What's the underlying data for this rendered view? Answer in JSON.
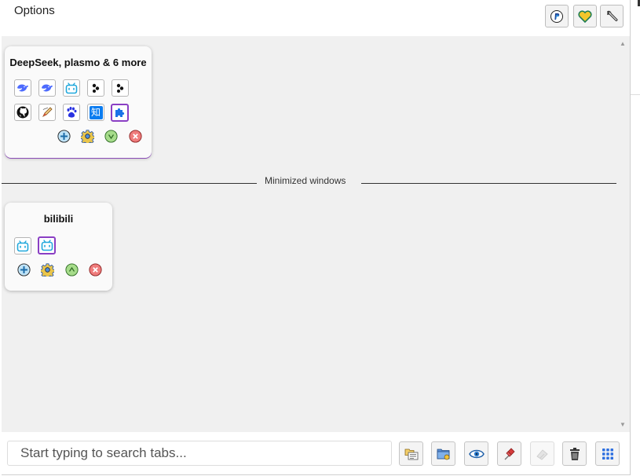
{
  "header": {
    "title": "Options"
  },
  "header_buttons": [
    {
      "name": "paypal-button",
      "icon": "paypal-icon"
    },
    {
      "name": "favorite-button",
      "icon": "heart-icon"
    },
    {
      "name": "settings-button",
      "icon": "wrench-icon"
    }
  ],
  "windows": [
    {
      "title": "DeepSeek, plasmo & 6 more",
      "tabs": [
        {
          "icon": "deepseek-icon"
        },
        {
          "icon": "deepseek-icon"
        },
        {
          "icon": "bilibili-icon"
        },
        {
          "icon": "plasmo-icon"
        },
        {
          "icon": "plasmo-icon"
        },
        {
          "icon": "github-icon"
        },
        {
          "icon": "extension-pencil-icon"
        },
        {
          "icon": "baidu-icon"
        },
        {
          "icon": "zhihu-icon",
          "text": "知"
        },
        {
          "icon": "puzzle-icon",
          "active": true
        }
      ],
      "actions": [
        "new-tab-icon",
        "settings-gear-icon",
        "minimize-icon",
        "close-window-icon"
      ]
    },
    {
      "title": "bilibili",
      "tabs": [
        {
          "icon": "bilibili-icon"
        },
        {
          "icon": "bilibili-icon",
          "active": true
        }
      ],
      "actions": [
        "new-tab-icon",
        "settings-gear-icon",
        "restore-icon",
        "close-window-icon"
      ]
    }
  ],
  "separator": {
    "label": "Minimized windows"
  },
  "search": {
    "placeholder": "Start typing to search tabs..."
  },
  "footer_buttons": [
    {
      "name": "group-tabs-button",
      "icon": "folders-icon"
    },
    {
      "name": "new-window-button",
      "icon": "folder-plus-icon"
    },
    {
      "name": "view-button",
      "icon": "eye-icon"
    },
    {
      "name": "pin-button",
      "icon": "pin-icon"
    },
    {
      "name": "clear-button",
      "icon": "eraser-icon",
      "disabled": true
    },
    {
      "name": "delete-button",
      "icon": "trash-icon"
    },
    {
      "name": "grid-button",
      "icon": "grid-icon"
    }
  ],
  "colors": {
    "accent_purple": "#8a3fc4",
    "action_blue": "#3fa2dc",
    "action_green": "#7cc95c",
    "action_red": "#e15b5b",
    "grid_blue": "#2d6fe0"
  }
}
